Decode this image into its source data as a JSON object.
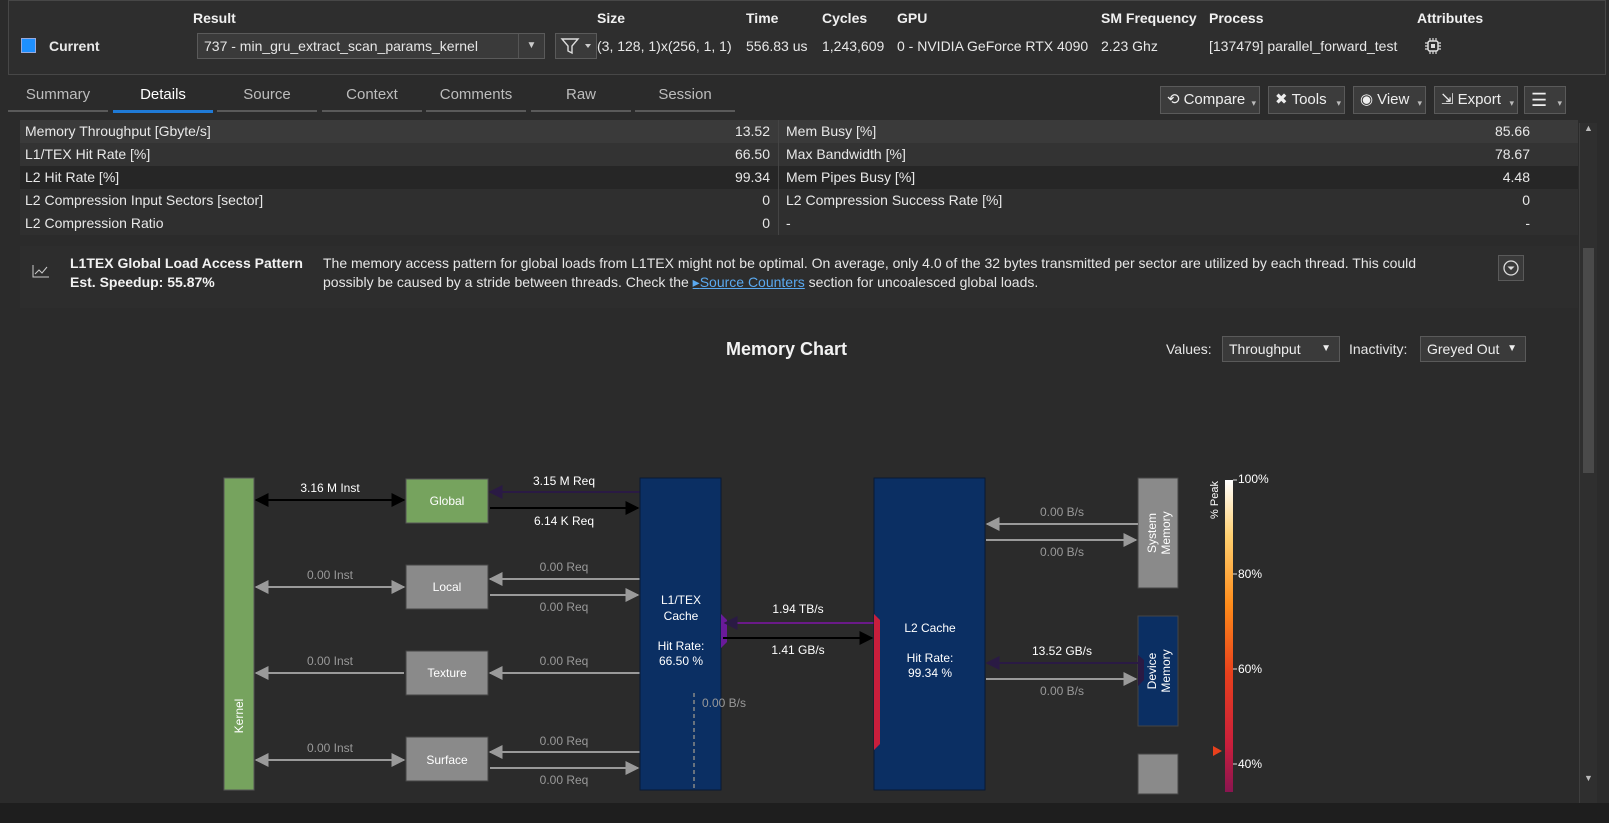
{
  "header": {
    "labels": {
      "result": "Result",
      "size": "Size",
      "time": "Time",
      "cycles": "Cycles",
      "gpu": "GPU",
      "sm_freq": "SM Frequency",
      "process": "Process",
      "attributes": "Attributes"
    },
    "current_label": "Current",
    "result_value": "737 - min_gru_extract_scan_params_kernel",
    "size_value": "(3, 128, 1)x(256, 1, 1)",
    "time_value": "556.83 us",
    "cycles_value": "1,243,609",
    "gpu_value": "0 - NVIDIA GeForce RTX 4090",
    "sm_freq_value": "2.23 Ghz",
    "process_value": "[137479] parallel_forward_test",
    "current_color": "#1e90ff"
  },
  "tabs": [
    "Summary",
    "Details",
    "Source",
    "Context",
    "Comments",
    "Raw",
    "Session"
  ],
  "active_tab": "Details",
  "toolbar": {
    "compare": "Compare",
    "tools": "Tools",
    "view": "View",
    "export": "Export"
  },
  "metrics": [
    {
      "l_name": "Memory Throughput [Gbyte/s]",
      "l_val": "13.52",
      "r_name": "Mem Busy [%]",
      "r_val": "85.66"
    },
    {
      "l_name": "L1/TEX Hit Rate [%]",
      "l_val": "66.50",
      "r_name": "Max Bandwidth [%]",
      "r_val": "78.67"
    },
    {
      "l_name": "L2 Hit Rate [%]",
      "l_val": "99.34",
      "r_name": "Mem Pipes Busy [%]",
      "r_val": "4.48"
    },
    {
      "l_name": "L2 Compression Input Sectors [sector]",
      "l_val": "0",
      "r_name": "L2 Compression Success Rate [%]",
      "r_val": "0"
    },
    {
      "l_name": "L2 Compression Ratio",
      "l_val": "0",
      "r_name": "-",
      "r_val": "-"
    }
  ],
  "advice": {
    "title": "L1TEX Global Load Access Pattern",
    "speedup": "Est. Speedup: 55.87%",
    "text1": "The memory access pattern for global loads from L1TEX might not be optimal. On average, only 4.0 of the 32 bytes transmitted per sector are utilized by each thread. This could",
    "text2a": "possibly be caused by a stride between threads. Check the ",
    "link": "Source Counters",
    "text2b": " section for uncoalesced global loads."
  },
  "memchart": {
    "title": "Memory Chart",
    "values_label": "Values:",
    "values_sel": "Throughput",
    "inactivity_label": "Inactivity:",
    "inactivity_sel": "Greyed Out",
    "kernel": "Kernel",
    "global": "Global",
    "local": "Local",
    "texture": "Texture",
    "surface": "Surface",
    "global_inst": "3.16 M Inst",
    "local_inst": "0.00 Inst",
    "texture_inst": "0.00 Inst",
    "surface_inst": "0.00 Inst",
    "global_req_in": "3.15 M Req",
    "global_req_out": "6.14 K Req",
    "local_req_in": "0.00 Req",
    "local_req_out": "0.00 Req",
    "texture_req": "0.00 Req",
    "surface_req_in": "0.00 Req",
    "surface_req_out": "0.00 Req",
    "l1_title1": "L1/TEX",
    "l1_title2": "Cache",
    "l1_hit_label": "Hit Rate:",
    "l1_hit": "66.50 %",
    "l1_shared": "0.00 B/s",
    "l1_l2_in": "1.94 TB/s",
    "l1_l2_out": "1.41 GB/s",
    "l2_title": "L2 Cache",
    "l2_hit_label": "Hit Rate:",
    "l2_hit": "99.34 %",
    "sys_in": "0.00 B/s",
    "sys_out": "0.00 B/s",
    "dev_in": "13.52 GB/s",
    "dev_out": "0.00 B/s",
    "sys_mem1": "System",
    "sys_mem2": "Memory",
    "dev_mem1": "Device",
    "dev_mem2": "Memory",
    "peak_label": "% Peak",
    "ticks": [
      "100%",
      "80%",
      "60%",
      "40%"
    ]
  }
}
